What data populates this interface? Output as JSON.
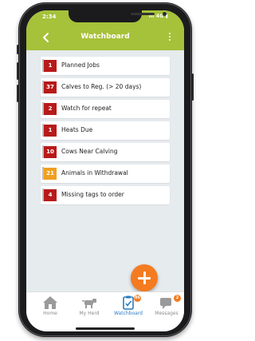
{
  "status": {
    "time": "2:34",
    "indicators": "ıll 4G ▮"
  },
  "header": {
    "title": "Watchboard"
  },
  "watchlist": [
    {
      "count": "1",
      "label": "Planned Jobs",
      "color": "#b81a1a"
    },
    {
      "count": "37",
      "label": "Calves to Reg. (> 20 days)",
      "color": "#b81a1a"
    },
    {
      "count": "2",
      "label": "Watch for repeat",
      "color": "#b81a1a"
    },
    {
      "count": "1",
      "label": "Heats Due",
      "color": "#b81a1a"
    },
    {
      "count": "10",
      "label": "Cows Near Calving",
      "color": "#b81a1a"
    },
    {
      "count": "21",
      "label": "Animals in Withdrawal",
      "color": "#f0a020"
    },
    {
      "count": "4",
      "label": "Missing tags to order",
      "color": "#b81a1a"
    }
  ],
  "tabs": [
    {
      "label": "Home",
      "icon": "home-icon",
      "badge": ""
    },
    {
      "label": "My Herd",
      "icon": "cow-icon",
      "badge": ""
    },
    {
      "label": "Watchboard",
      "icon": "clipboard-icon",
      "badge": "86",
      "active": true
    },
    {
      "label": "Messages",
      "icon": "chat-icon",
      "badge": "2"
    }
  ],
  "colors": {
    "accent": "#a6c13a",
    "fab": "#f47b20",
    "active_tab": "#2a7bbf",
    "badge": "#f47b20"
  }
}
